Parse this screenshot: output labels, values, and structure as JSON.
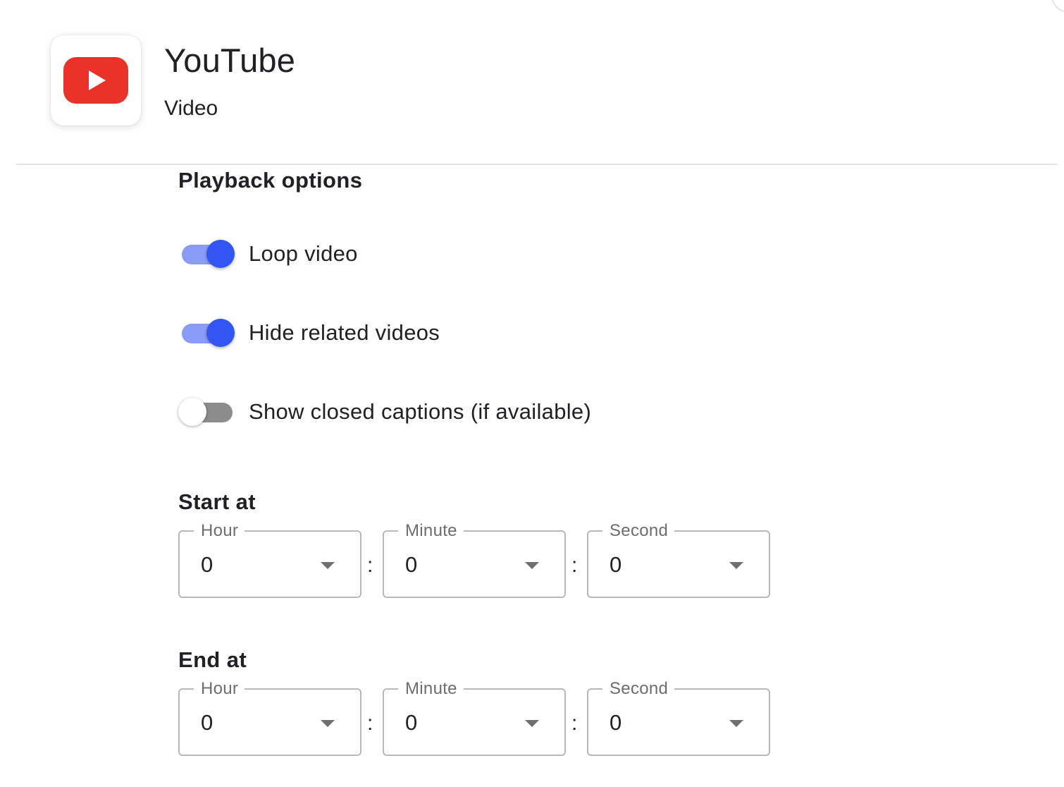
{
  "header": {
    "app_name": "YouTube",
    "app_type": "Video",
    "icon": "youtube-logo-icon",
    "brand_color": "#e8322a"
  },
  "playback": {
    "heading": "Playback options",
    "accent_color": "#3355f2",
    "toggles": [
      {
        "label": "Loop video",
        "on": true
      },
      {
        "label": "Hide related videos",
        "on": true
      },
      {
        "label": "Show closed captions (if available)",
        "on": false
      }
    ]
  },
  "start_at": {
    "heading": "Start at",
    "hour": {
      "label": "Hour",
      "value": "0"
    },
    "minute": {
      "label": "Minute",
      "value": "0"
    },
    "second": {
      "label": "Second",
      "value": "0"
    }
  },
  "end_at": {
    "heading": "End at",
    "hour": {
      "label": "Hour",
      "value": "0"
    },
    "minute": {
      "label": "Minute",
      "value": "0"
    },
    "second": {
      "label": "Second",
      "value": "0"
    }
  },
  "separator": ":"
}
